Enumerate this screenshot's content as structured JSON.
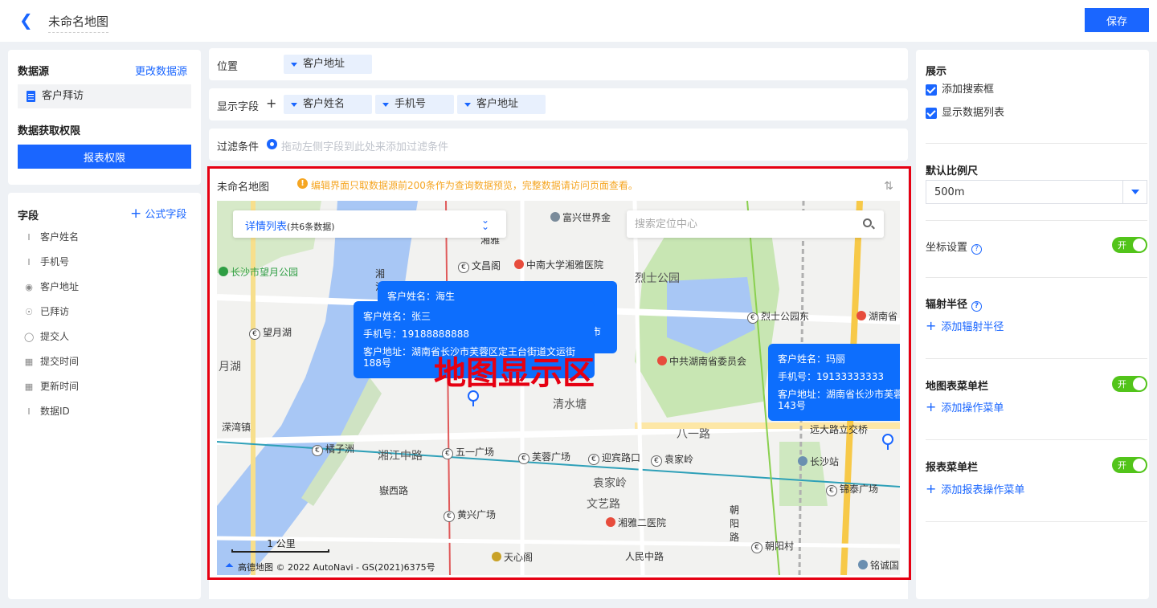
{
  "header": {
    "title": "未命名地图",
    "save_label": "保存"
  },
  "datasource": {
    "heading": "数据源",
    "change_link": "更改数据源",
    "source_name": "客户拜访",
    "permission_heading": "数据获取权限",
    "permission_button": "报表权限"
  },
  "fields": {
    "heading": "字段",
    "add_formula": "公式字段",
    "items": [
      {
        "label": "客户姓名",
        "icon": "text-icon"
      },
      {
        "label": "手机号",
        "icon": "text-icon"
      },
      {
        "label": "客户地址",
        "icon": "location-icon"
      },
      {
        "label": "已拜访",
        "icon": "radio-icon"
      },
      {
        "label": "提交人",
        "icon": "user-icon"
      },
      {
        "label": "提交时间",
        "icon": "calendar-icon"
      },
      {
        "label": "更新时间",
        "icon": "calendar-icon"
      },
      {
        "label": "数据ID",
        "icon": "text-icon"
      }
    ]
  },
  "config": {
    "position_label": "位置",
    "position_chip": "客户地址",
    "display_label": "显示字段",
    "display_chips": [
      "客户姓名",
      "手机号",
      "客户地址"
    ],
    "filter_label": "过滤条件",
    "filter_hint": "拖动左侧字段到此处来添加过滤条件"
  },
  "map": {
    "title": "未命名地图",
    "warning": "编辑界面只取数据源前200条作为查询数据预览，完整数据请访问页面查看。",
    "list_title": "详情列表",
    "list_count": "(共6条数据)",
    "search_placeholder": "搜索定位中心",
    "overlay_label": "地图显示区",
    "scale_label": "1 公里",
    "copyright": "高德地图 © 2022 AutoNavi - GS(2021)6375号",
    "popups": [
      {
        "name_line": "客户姓名：海生",
        "extra": "市"
      },
      {
        "name_line": "客户姓名：张三",
        "phone_line": "手机号：19188888888",
        "addr_line": "客户地址：湖南省长沙市芙蓉区定王台街道文运街",
        "addr_line2": "188号"
      },
      {
        "name_line": "客户姓名：玛丽",
        "phone_line": "手机号：19133333333",
        "addr_line": "客户地址：湖南省长沙市芙蓉",
        "addr_line2": "143号"
      }
    ],
    "labels": {
      "l1": "富兴世界金",
      "l2": "湘雅",
      "l3": "文昌阁",
      "l4": "中南大学湘雅医院",
      "l5": "长沙市望月公园",
      "l6": "烈士公园",
      "l7": "烈士公园东",
      "l8": "湖南省",
      "l9": "望月湖",
      "l10": "月湖",
      "l11": "中共湖南省委员会",
      "l12": "清水塘",
      "l13": "八一路",
      "l14": "远大路立交桥",
      "l15": "溁湾镇",
      "l16": "橘子洲",
      "l17": "湘江中路",
      "l18": "五一广场",
      "l19": "芙蓉广场",
      "l20": "迎宾路口",
      "l21": "袁家岭",
      "l22": "长沙站",
      "l23": "锦泰广场",
      "l24": "嶽西路",
      "l25": "袁家岭",
      "l26": "文艺路",
      "l27": "黄兴广场",
      "l28": "湘雅二医院",
      "l29": "朝",
      "l30": "阳",
      "l31": "路",
      "l32": "朝阳村",
      "l33": "天心阁",
      "l34": "人民中路",
      "l35": "铭诚国",
      "l36": "湘",
      "l37": "江"
    }
  },
  "right": {
    "display_heading": "展示",
    "add_search": "添加搜索框",
    "show_list": "显示数据列表",
    "scale_heading": "默认比例尺",
    "scale_value": "500m",
    "coord_label": "坐标设置",
    "coord_toggle": "开",
    "radius_heading": "辐射半径",
    "add_radius": "添加辐射半径",
    "map_menu_heading": "地图表菜单栏",
    "map_menu_toggle": "开",
    "add_map_menu": "添加操作菜单",
    "report_menu_heading": "报表菜单栏",
    "report_menu_toggle": "开",
    "add_report_menu": "添加报表操作菜单"
  }
}
